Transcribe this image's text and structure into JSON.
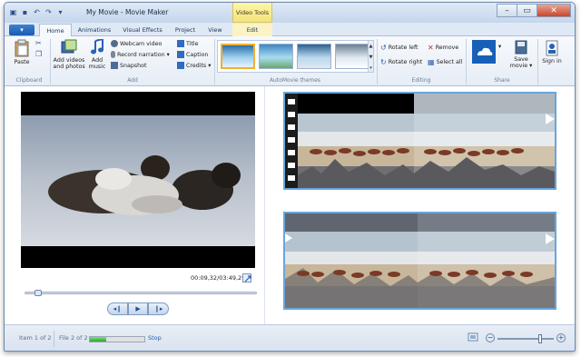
{
  "title_bar": {
    "title": "My Movie - Movie Maker",
    "contextual_tab_group": "Video Tools",
    "minimize_icon": "minimize-icon",
    "maximize_icon": "maximize-icon",
    "close_icon": "close-icon"
  },
  "tabs": {
    "file_label": "▾",
    "items": [
      "Home",
      "Animations",
      "Visual Effects",
      "Project",
      "View",
      "Edit"
    ],
    "active": "Home"
  },
  "ribbon": {
    "clipboard": {
      "paste": "Paste",
      "group_label": "Clipboard"
    },
    "add": {
      "add_videos": "Add videos and photos",
      "add_music": "Add music",
      "webcam_video": "Webcam video",
      "record_narration": "Record narration",
      "snapshot": "Snapshot",
      "title": "Title",
      "caption": "Caption",
      "credits": "Credits",
      "group_label": "Add"
    },
    "themes": {
      "group_label": "AutoMovie themes",
      "selected_index": 0
    },
    "editing": {
      "rotate_left": "Rotate left",
      "rotate_right": "Rotate right",
      "remove": "Remove",
      "select_all": "Select all",
      "group_label": "Editing"
    },
    "share": {
      "save_movie": "Save movie",
      "sign_in": "Sign in",
      "group_label": "Share"
    }
  },
  "player": {
    "timecode": "00:09,32/03:49,29",
    "seek_position_fraction": 0.04
  },
  "status_bar": {
    "item_info": "Item 1 of 2",
    "file_info": "File 2 of 2",
    "progress_fraction": 0.3,
    "stop": "Stop",
    "zoom_fraction": 0.75
  },
  "colors": {
    "accent": "#1f5fb4",
    "selection_border": "#6aa5dc",
    "progress_green": "#2ea42e"
  }
}
